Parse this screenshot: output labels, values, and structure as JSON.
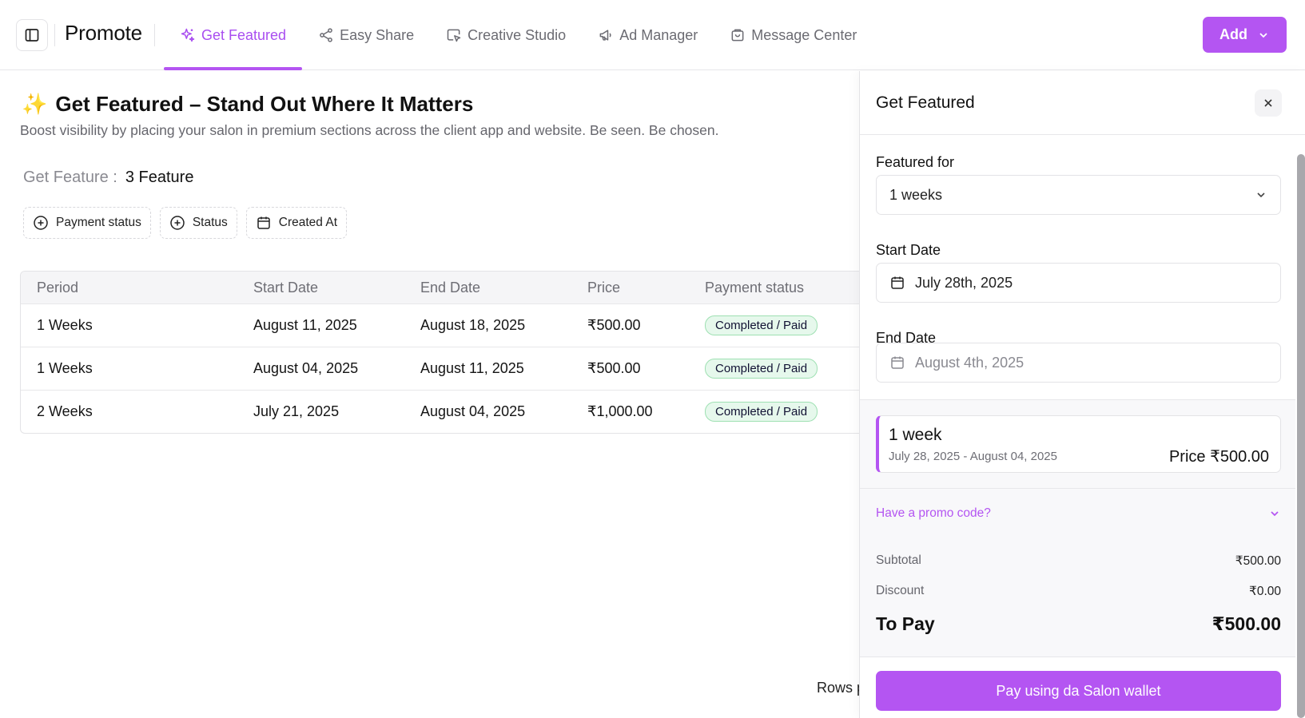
{
  "header": {
    "title": "Promote",
    "tabs": [
      {
        "label": "Get Featured",
        "icon": "sparkle-icon",
        "active": true
      },
      {
        "label": "Easy Share",
        "icon": "share-icon",
        "active": false
      },
      {
        "label": "Creative Studio",
        "icon": "image-cursor-icon",
        "active": false
      },
      {
        "label": "Ad Manager",
        "icon": "megaphone-icon",
        "active": false
      },
      {
        "label": "Message Center",
        "icon": "inbox-icon",
        "active": false
      }
    ],
    "add_label": "Add"
  },
  "main": {
    "emoji": "✨",
    "title": "Get Featured – Stand Out Where It Matters",
    "description": "Boost visibility by placing your salon in premium sections across the client app and website. Be seen. Be chosen.",
    "feature_label": "Get Feature :",
    "feature_value": "3 Feature",
    "filters": [
      "Payment status",
      "Status",
      "Created At"
    ],
    "table": {
      "columns": [
        "Period",
        "Start Date",
        "End Date",
        "Price",
        "Payment status"
      ],
      "rows": [
        [
          "1 Weeks",
          "August 11, 2025",
          "August 18, 2025",
          "₹500.00",
          "Completed / Paid"
        ],
        [
          "1 Weeks",
          "August 04, 2025",
          "August 11, 2025",
          "₹500.00",
          "Completed / Paid"
        ],
        [
          "2 Weeks",
          "July 21, 2025",
          "August 04, 2025",
          "₹1,000.00",
          "Completed / Paid"
        ]
      ]
    },
    "rows_label": "Rows p"
  },
  "panel": {
    "title": "Get Featured",
    "featured_for_label": "Featured for",
    "featured_for_value": "1 weeks",
    "start_date_label": "Start Date",
    "start_date_value": "July 28th, 2025",
    "end_date_label": "End Date",
    "end_date_value": "August 4th, 2025",
    "summary": {
      "week_title": "1 week",
      "week_range": "July 28, 2025 - August 04, 2025",
      "week_price": "Price ₹500.00"
    },
    "promo_label": "Have a promo code?",
    "subtotal_label": "Subtotal",
    "subtotal_value": "₹500.00",
    "discount_label": "Discount",
    "discount_value": "₹0.00",
    "topay_label": "To Pay",
    "topay_value": "₹500.00",
    "pay_button": "Pay using da Salon wallet"
  },
  "colors": {
    "accent": "#b455f2",
    "badge_bg": "#e6f8ec",
    "badge_border": "#9ee0b2"
  }
}
